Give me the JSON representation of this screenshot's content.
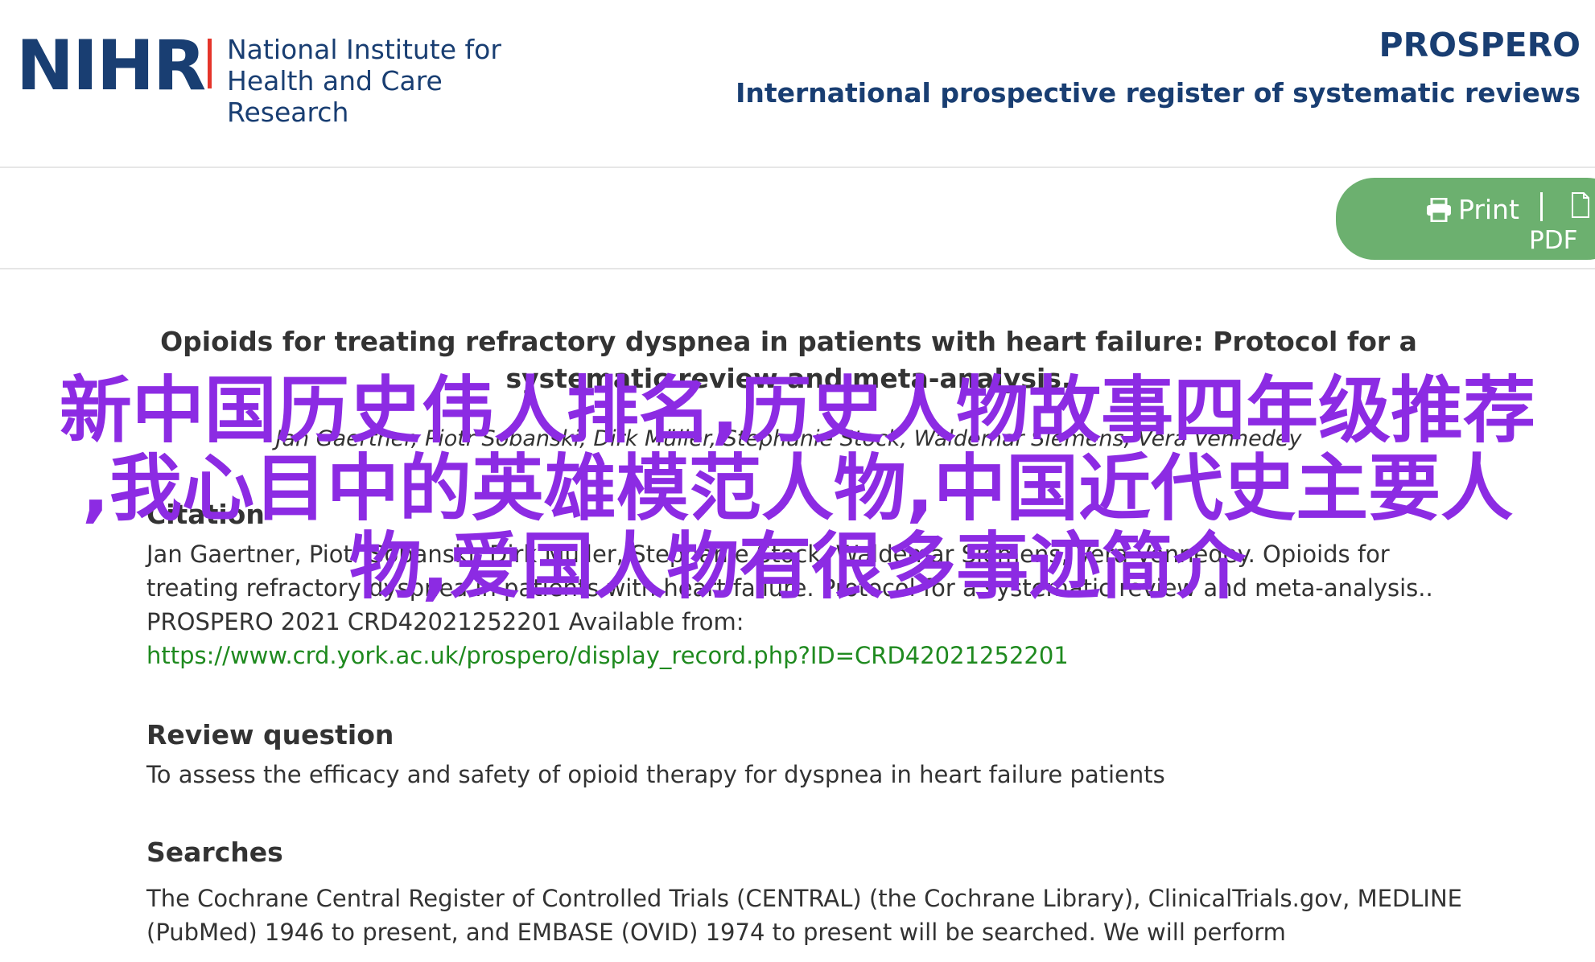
{
  "header": {
    "logo_mark": "NIHR",
    "logo_name_line1": "National Institute for",
    "logo_name_line2": "Health and Care Research",
    "site_title": "PROSPERO",
    "site_subtitle": "International prospective register of systematic reviews"
  },
  "toolbar": {
    "print_label": "Print",
    "pdf_label": "PDF",
    "pill_color": "#6cb06f"
  },
  "record": {
    "title": "Opioids for treating refractory dyspnea in patients with heart failure: Protocol for a systematic review and meta-analysis.",
    "authors": "Jan Gaertner, Piotr Sobanski, Dirk Müller, Stephanie Stock, Waldemar Siemens, Vera Vennedey"
  },
  "citation": {
    "heading": "Citation",
    "text": "Jan Gaertner, Piotr Sobanski, Dirk Müller, Stephanie Stock, Waldemar Siemens, Vera Vennedey. Opioids for treating refractory dyspnea in patients with heart failure. Protocol for a systematic review and meta-analysis.. PROSPERO 2021 CRD42021252201 Available from:",
    "link": "https://www.crd.york.ac.uk/prospero/display_record.php?ID=CRD42021252201"
  },
  "review_question": {
    "heading": "Review question",
    "text": "To assess the efficacy and safety of opioid therapy for dyspnea in heart failure patients"
  },
  "searches": {
    "heading": "Searches",
    "text": "The Cochrane Central Register of Controlled Trials (CENTRAL) (the Cochrane Library), ClinicalTrials.gov, MEDLINE (PubMed) 1946 to present, and EMBASE (OVID) 1974 to present will be searched. We will perform"
  },
  "overlay": {
    "line1": "新中国历史伟人排名,历史人物故事四年级推荐",
    "line2": ",我心目中的英雄模范人物,中国近代史主要人",
    "line3": "物,爱国人物有很多事迹简介",
    "color": "#8c2be3"
  },
  "colors": {
    "brand_navy": "#193e72",
    "brand_red": "#e5352b",
    "link_green": "#1f8a1f"
  }
}
